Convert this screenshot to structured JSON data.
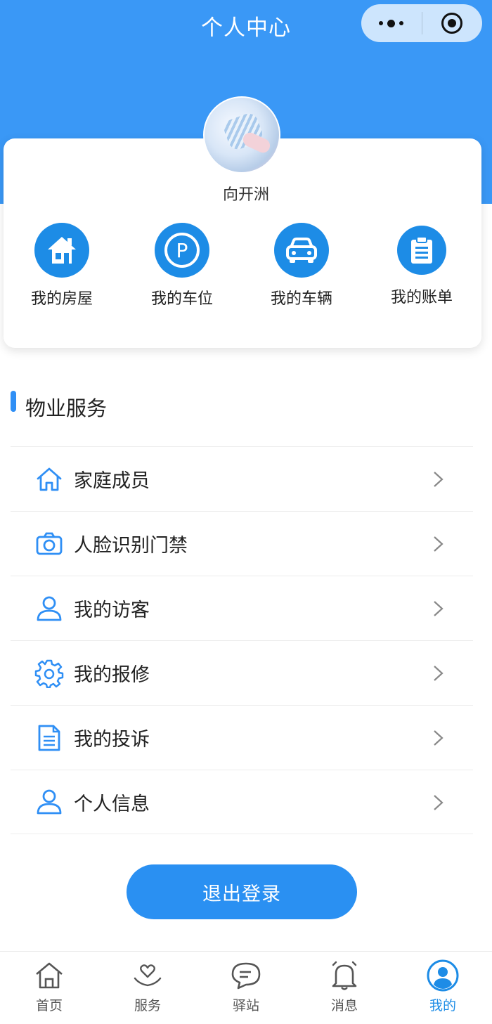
{
  "nav": {
    "title": "个人中心"
  },
  "profile": {
    "name": "向开洲"
  },
  "quick_actions": [
    {
      "label": "我的房屋",
      "icon": "house-icon"
    },
    {
      "label": "我的车位",
      "icon": "parking-icon"
    },
    {
      "label": "我的车辆",
      "icon": "car-icon"
    },
    {
      "label": "我的账单",
      "icon": "bill-icon"
    }
  ],
  "section": {
    "title": "物业服务"
  },
  "menu": [
    {
      "label": "家庭成员",
      "icon": "home-outline-icon"
    },
    {
      "label": "人脸识别门禁",
      "icon": "camera-icon"
    },
    {
      "label": "我的访客",
      "icon": "user-icon"
    },
    {
      "label": "我的报修",
      "icon": "gear-icon"
    },
    {
      "label": "我的投诉",
      "icon": "document-icon"
    },
    {
      "label": "个人信息",
      "icon": "user-icon"
    }
  ],
  "logout": {
    "label": "退出登录"
  },
  "tabs": [
    {
      "label": "首页",
      "icon": "home-tab-icon"
    },
    {
      "label": "服务",
      "icon": "heart-hand-icon"
    },
    {
      "label": "驿站",
      "icon": "chat-icon"
    },
    {
      "label": "消息",
      "icon": "bell-icon"
    },
    {
      "label": "我的",
      "icon": "profile-icon",
      "active": true
    }
  ],
  "colors": {
    "primary": "#3a98f6",
    "accent": "#1d8ce6"
  }
}
